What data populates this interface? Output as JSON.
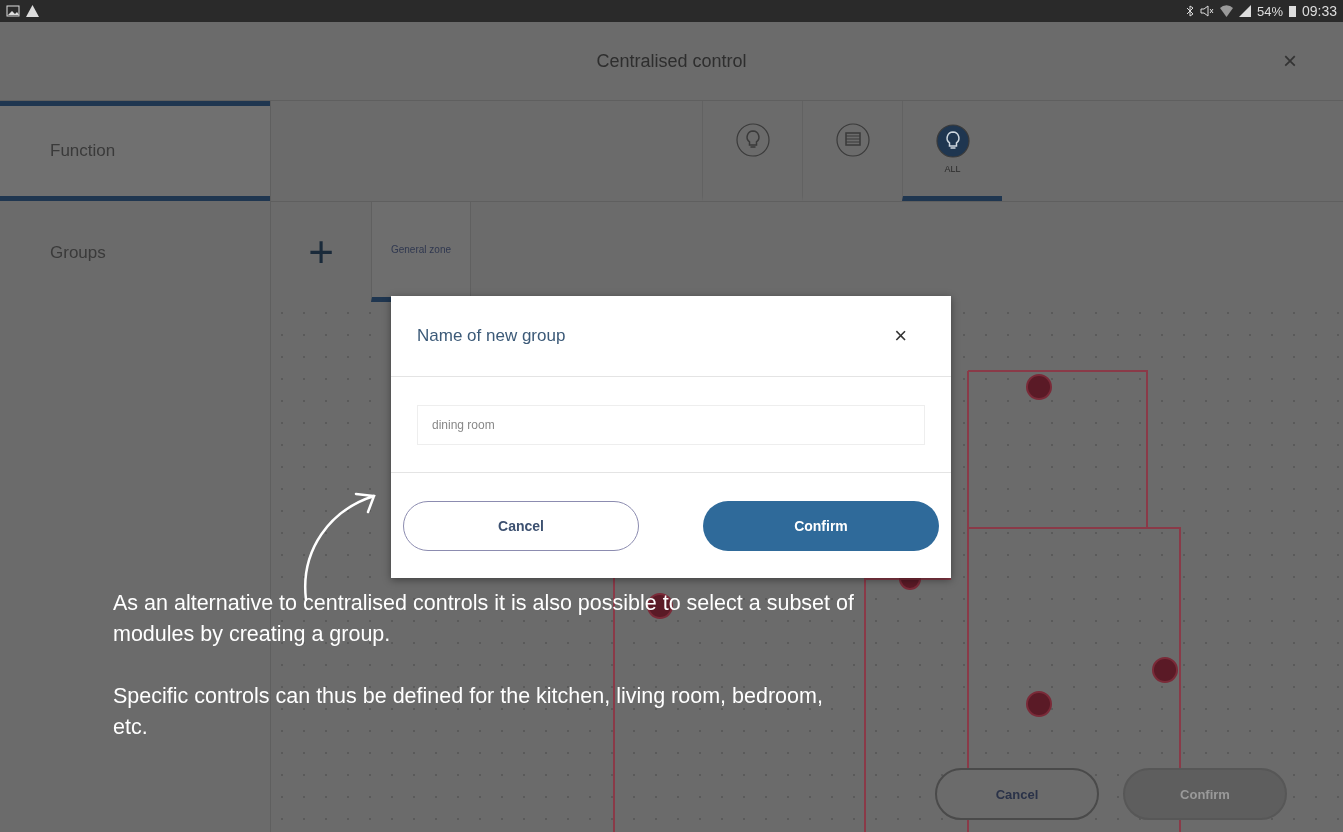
{
  "status_bar": {
    "battery": "54%",
    "time": "09:33"
  },
  "header": {
    "title": "Centralised control",
    "close": "×"
  },
  "sidebar": {
    "items": [
      {
        "label": "Function",
        "selected": true
      },
      {
        "label": "Groups",
        "selected": false
      }
    ]
  },
  "function_tabs": [
    {
      "kind": "lamp",
      "selected": false
    },
    {
      "kind": "shutter",
      "selected": false
    },
    {
      "kind": "all",
      "label": "ALL",
      "selected": true
    }
  ],
  "groups": {
    "add": "+",
    "items": [
      {
        "label": "General zone",
        "selected": true
      }
    ]
  },
  "dialog": {
    "title": "Name of new group",
    "close": "×",
    "value": "dining room",
    "cancel": "Cancel",
    "confirm": "Confirm"
  },
  "annotation": {
    "paragraphs": [
      "As an alternative to centralised controls it is also possible to select a subset of modules by creating a group.",
      "Specific controls can thus be defined for the kitchen, living room, bedroom, etc."
    ]
  },
  "footer": {
    "buttons": [
      {
        "label": "Cancel",
        "disabled": false
      },
      {
        "label": "Confirm",
        "disabled": true
      }
    ]
  }
}
